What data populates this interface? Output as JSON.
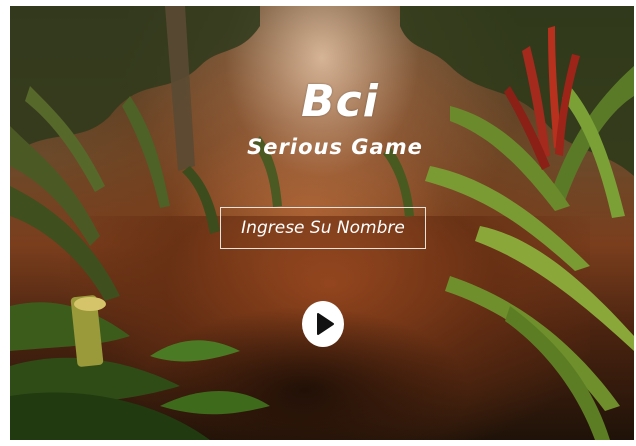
{
  "title": "Bci",
  "subtitle": "Serious Game",
  "name_input": {
    "placeholder": "Ingrese Su Nombre",
    "value": ""
  },
  "play_button": {
    "icon": "play-icon"
  },
  "colors": {
    "text": "#ffffff",
    "input_border": "#e8e2da",
    "button_bg": "#ffffff",
    "button_icon": "#111111"
  }
}
